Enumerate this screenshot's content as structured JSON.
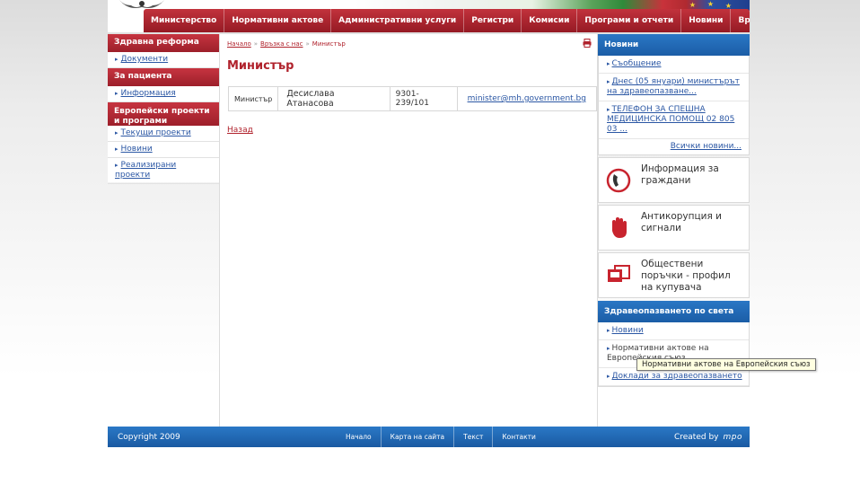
{
  "top_nav": [
    "Министерство",
    "Нормативни актове",
    "Административни услуги",
    "Регистри",
    "Комисии",
    "Програми и отчети",
    "Новини",
    "Връзки"
  ],
  "left_sidebar": {
    "sections": [
      {
        "title": "Здравна реформа",
        "items": [
          "Документи"
        ]
      },
      {
        "title": "За пациента",
        "items": [
          "Информация"
        ]
      },
      {
        "title": "Европейски проекти и програми",
        "items": [
          "Текущи проекти",
          "Новини",
          "Реализирани проекти"
        ]
      }
    ]
  },
  "breadcrumb": {
    "home": "Начало",
    "contact": "Връзка с нас",
    "current": "Министър",
    "separator": "»"
  },
  "page_title": "Министър",
  "contact_table": {
    "position": "Министър",
    "name": "Десислава Атанасова",
    "phone": "9301-239/101",
    "email": "minister@mh.government.bg"
  },
  "back_link": "Назад",
  "news": {
    "title": "Новини",
    "items": [
      "Съобщение",
      "Днес (05 януари) министърът на здравеопазване...",
      "ТЕЛЕФОН ЗА СПЕШНА МЕДИЦИНСКА ПОМОЩ 02 805 03 ..."
    ],
    "all_link": "Всички новини..."
  },
  "promos": [
    {
      "icon": "phone-icon",
      "text": "Информация за граждани"
    },
    {
      "icon": "hand-stop-icon",
      "text": "Антикорупция и сигнали"
    },
    {
      "icon": "procurement-icon",
      "text": "Обществени поръчки - профил на купувача"
    }
  ],
  "world_health": {
    "title": "Здравеопазването по света",
    "items": [
      "Новини",
      "Нормативни актове на Европейския съюз",
      "Доклади за здравеопазването"
    ]
  },
  "tooltip": "Нормативни актове на Европейския съюз",
  "footer": {
    "copyright": "Copyright 2009",
    "links": [
      "Начало",
      "Карта на сайта",
      "Текст",
      "Контакти"
    ],
    "created_by": "Created by",
    "creator_logo": "mpo"
  },
  "colors": {
    "brand_red": "#b0222c",
    "brand_blue": "#1f63ad",
    "link_blue": "#2b57a4"
  }
}
